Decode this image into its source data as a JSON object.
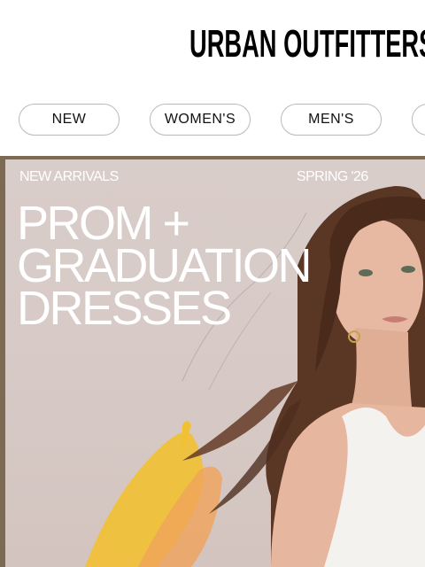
{
  "header": {
    "logo_text": "URBAN OUTFITTERS"
  },
  "nav": {
    "items": [
      {
        "label": "NEW"
      },
      {
        "label": "WOMEN'S"
      },
      {
        "label": "MEN'S"
      },
      {
        "label": ""
      }
    ]
  },
  "hero": {
    "eyebrow_left": "NEW ARRIVALS",
    "eyebrow_right": "SPRING '26",
    "headline_lines": [
      "PROM +",
      "GRADUATION",
      "DRESSES"
    ]
  },
  "colors": {
    "accent": "#000000",
    "hero_frame": "#7d6a52",
    "hero_background": "#d9cdc9",
    "headline_text": "#ffffff"
  }
}
